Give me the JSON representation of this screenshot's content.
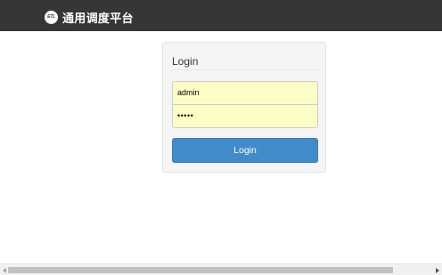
{
  "header": {
    "logo_text": "ETL",
    "title": "通用调度平台"
  },
  "login": {
    "title": "Login",
    "username_value": "admin",
    "password_value": "•••••",
    "button_label": "Login"
  },
  "scrollbar": {
    "horizontal_position": 0
  }
}
